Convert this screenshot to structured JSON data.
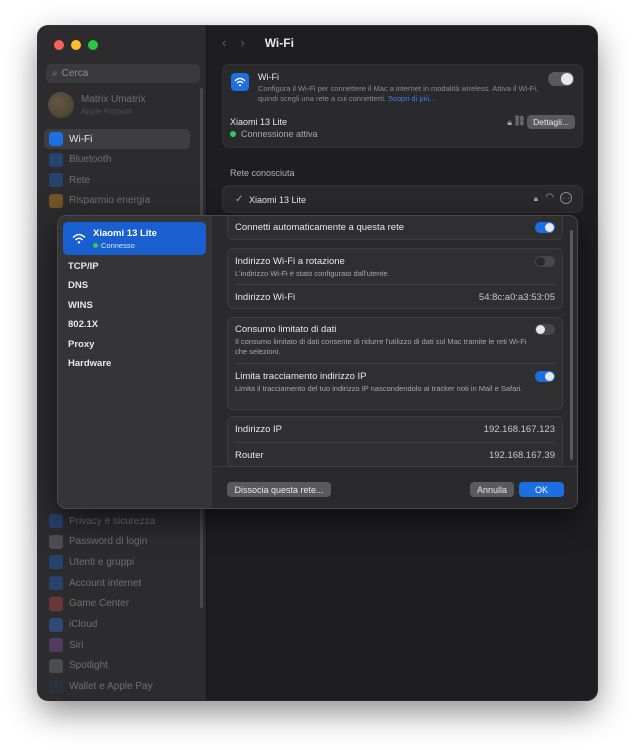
{
  "sidebar": {
    "search_placeholder": "Cerca",
    "user": {
      "name": "Matrix Umatrix",
      "subtitle": "Apple Account"
    },
    "items": [
      {
        "label": "Wi-Fi",
        "icon": "wifi-icon",
        "color": "#1b6fe0",
        "selected": true
      },
      {
        "label": "Bluetooth",
        "icon": "bluetooth-icon",
        "color": "#1b6fe0"
      },
      {
        "label": "Rete",
        "icon": "globe-icon",
        "color": "#1b6fe0"
      },
      {
        "label": "Risparmio energia",
        "icon": "battery-icon",
        "color": "#f39c12"
      }
    ],
    "items_bottom": [
      {
        "label": "Privacy e sicurezza",
        "icon": "hand-icon",
        "color": "#1b6fe0"
      },
      {
        "label": "Password di login",
        "icon": "lock-icon",
        "color": "#8e8e93"
      },
      {
        "label": "Utenti e gruppi",
        "icon": "users-icon",
        "color": "#1b6fe0"
      },
      {
        "label": "Account internet",
        "icon": "at-icon",
        "color": "#1b6fe0"
      },
      {
        "label": "Game Center",
        "icon": "gamecenter-icon",
        "color": "#e05050"
      },
      {
        "label": "iCloud",
        "icon": "cloud-icon",
        "color": "#3a82f7"
      },
      {
        "label": "Siri",
        "icon": "siri-icon",
        "color": "#9b59b6"
      },
      {
        "label": "Spotlight",
        "icon": "spotlight-icon",
        "color": "#7f8c8d"
      },
      {
        "label": "Wallet e Apple Pay",
        "icon": "wallet-icon",
        "color": "#2c3e50"
      }
    ]
  },
  "header": {
    "title": "Wi-Fi"
  },
  "wifi_card": {
    "title": "Wi-Fi",
    "description": "Configura il Wi-Fi per connettere il Mac a internet in modalità wireless. Attiva il Wi-Fi, quindi scegli una rete a cui connetterti.",
    "link": "Scopri di più...",
    "enabled": true
  },
  "current_network": {
    "name": "Xiaomi 13 Lite",
    "status": "Connessione attiva",
    "details_button": "Dettagli..."
  },
  "known_networks": {
    "heading": "Rete conosciuta",
    "items": [
      {
        "name": "Xiaomi 13 Lite"
      }
    ]
  },
  "dialog": {
    "network": {
      "name": "Xiaomi 13 Lite",
      "status": "Connesso"
    },
    "nav": [
      "TCP/IP",
      "DNS",
      "WINS",
      "802.1X",
      "Proxy",
      "Hardware"
    ],
    "auto_connect": {
      "label": "Connetti automaticamente a questa rete",
      "on": true
    },
    "rotating": {
      "label": "Indirizzo Wi-Fi a rotazione",
      "desc": "L'indirizzo Wi-Fi è stato configurato dall'utente.",
      "on": false
    },
    "wifi_address": {
      "label": "Indirizzo Wi-Fi",
      "value": "54:8c:a0:a3:53:05"
    },
    "low_data": {
      "label": "Consumo limitato di dati",
      "desc": "Il consumo limitato di dati consente di ridurre l'utilizzo di dati sul Mac tramite le reti Wi-Fi che selezioni.",
      "on": false
    },
    "limit_tracking": {
      "label": "Limita tracciamento indirizzo IP",
      "desc": "Limita il tracciamento del tuo indirizzo IP nascondendolo ai tracker noti in Mail e Safari.",
      "on": true
    },
    "ip": {
      "label": "Indirizzo IP",
      "value": "192.168.167.123"
    },
    "router": {
      "label": "Router",
      "value": "192.168.167.39"
    },
    "buttons": {
      "forget": "Dissocia questa rete...",
      "cancel": "Annulla",
      "ok": "OK"
    }
  },
  "colors": {
    "accent": "#1b6fe0",
    "status_green": "#34c759"
  }
}
